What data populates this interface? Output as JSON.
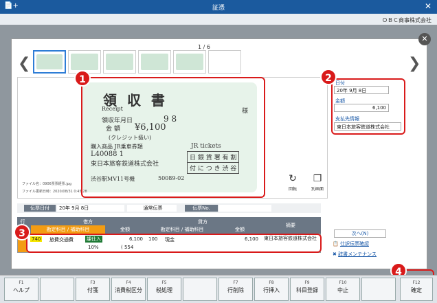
{
  "window": {
    "title": "証憑",
    "company": "ＯＢＣ商事株式会社",
    "app_icon": "📄+"
  },
  "pager": "1 / 6",
  "receipt": {
    "title": "領 収 書",
    "subtitle": "Receipt",
    "sama": "様",
    "date_label": "領収年月日",
    "date_val": "9 8",
    "amount_label": "金 額",
    "amount_val": "¥6,100",
    "card": "(クレジット扱い)",
    "item": "購入商品 JR乗車券類",
    "num": "L40088 1",
    "company": "東日本旅客鉄道株式会社",
    "machine": "渋谷駅MV11号機",
    "code": "50089-02",
    "stamp1": "日 銀 貨 署 有 割",
    "stamp2": "付 に つ き 渋 谷",
    "ticket": "JR tickets"
  },
  "fileinfo": {
    "name": "ファイル名：0906票票経票.jpg",
    "date": "ファイル更新日時：2020/08/31 0:45:28"
  },
  "viewer_buttons": {
    "rotate": "回転",
    "separate": "別画面"
  },
  "side": {
    "date_label": "日付",
    "date_value": "20年 9月 8日",
    "amount_label": "金額",
    "amount_value": "6,100",
    "payee_label": "支払先情報",
    "payee_value": "東日本旅客鉄道株式会社"
  },
  "header": {
    "date_label": "伝票日付",
    "date_value": "20年 9月 8日",
    "type_value": "通常伝票",
    "no_label": "伝票No.",
    "no_value": ""
  },
  "grid": {
    "row_label": "行",
    "debit": "借方",
    "credit": "貸方",
    "account": "勘定科目 / 補助科目",
    "amount": "金額",
    "summary": "摘要",
    "rows": [
      {
        "d_code": "740",
        "d_name": "旅費交通費",
        "d_tax_badge": "課仕入",
        "d_tax_rate": "10%",
        "d_amount": "6,100",
        "d_tax_amount": "( 554",
        "c_code": "100",
        "c_name": "現金",
        "c_amount": "6,100",
        "summary": "東日本旅客鉄道株式会社"
      }
    ]
  },
  "links": {
    "next": "次へ(N)",
    "confirm": "仕訳伝票確認",
    "dict": "辞書メンテナンス"
  },
  "fkeys": [
    {
      "n": "F1",
      "l": "ヘルプ"
    },
    {
      "n": "",
      "l": ""
    },
    {
      "n": "F3",
      "l": "付箋"
    },
    {
      "n": "F4",
      "l": "消費税区分"
    },
    {
      "n": "F5",
      "l": "税処理"
    },
    {
      "n": "",
      "l": ""
    },
    {
      "n": "F7",
      "l": "行削除"
    },
    {
      "n": "F8",
      "l": "行挿入"
    },
    {
      "n": "F9",
      "l": "科目登録"
    },
    {
      "n": "F10",
      "l": "中止"
    },
    {
      "n": "",
      "l": ""
    },
    {
      "n": "F12",
      "l": "確定"
    }
  ],
  "badges": [
    "1",
    "2",
    "3",
    "4"
  ],
  "colors": {
    "accent_red": "#d91a1a",
    "titlebar": "#1b5a9e",
    "orange": "#f39c12"
  }
}
